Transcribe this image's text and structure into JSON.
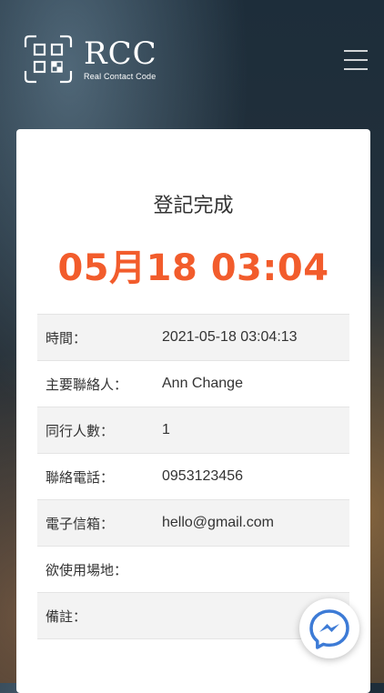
{
  "brand": {
    "name": "RCC",
    "tagline": "Real Contact Code"
  },
  "icons": {
    "logo": "rcc-logo-icon",
    "menu": "hamburger-menu-icon",
    "chat": "messenger-icon"
  },
  "page": {
    "title": "登記完成",
    "big_time": "05月18 03:04"
  },
  "info": [
    {
      "label": "時間：",
      "value": "2021-05-18 03:04:13"
    },
    {
      "label": "主要聯絡人：",
      "value": "Ann Change"
    },
    {
      "label": "同行人數：",
      "value": "1"
    },
    {
      "label": "聯絡電話：",
      "value": "0953123456"
    },
    {
      "label": "電子信箱：",
      "value": "hello@gmail.com"
    },
    {
      "label": "欲使用場地：",
      "value": ""
    },
    {
      "label": "備註：",
      "value": ""
    }
  ],
  "colors": {
    "accent": "#f25c2c",
    "messenger": "#3d7bd6"
  }
}
